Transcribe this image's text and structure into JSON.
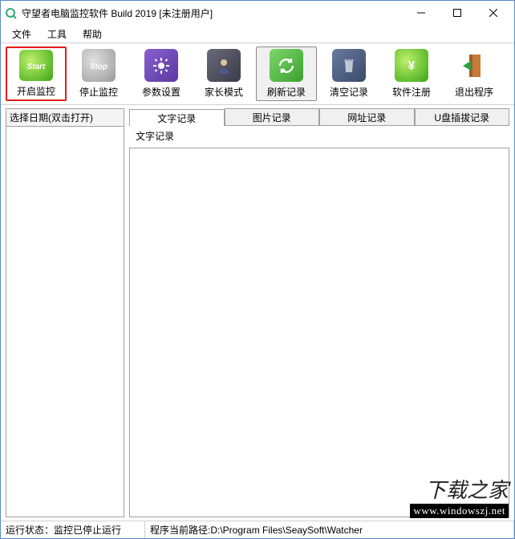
{
  "title": "守望者电脑监控软件    Build 2019      [未注册用户]",
  "menu": {
    "file": "文件",
    "tools": "工具",
    "help": "帮助"
  },
  "toolbar": {
    "start": "开启监控",
    "stop": "停止监控",
    "settings": "参数设置",
    "parent": "家长模式",
    "refresh": "刷新记录",
    "clear": "清空记录",
    "register": "软件注册",
    "exit": "退出程序"
  },
  "left": {
    "header": "选择日期(双击打开)"
  },
  "tabs": {
    "text": "文字记录",
    "image": "图片记录",
    "url": "网址记录",
    "usb": "U盘插拔记录"
  },
  "subheader": "文字记录",
  "status": {
    "label": "运行状态：",
    "value": "监控已停止运行",
    "pathlabel": "程序当前路径:",
    "path": "D:\\Program Files\\SeaySoft\\Watcher"
  },
  "watermark": {
    "line1": "下载之家",
    "line2": "www.windowszj.net"
  }
}
